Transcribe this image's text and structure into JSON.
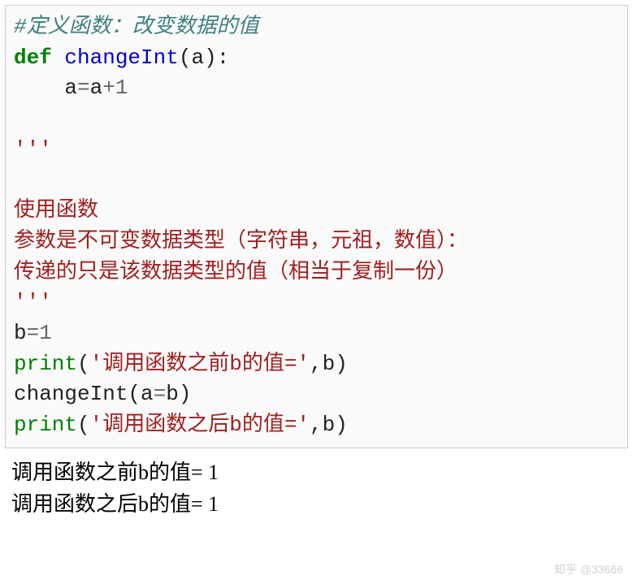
{
  "code": {
    "comment_line": "#定义函数：改变数据的值",
    "def_kw": "def",
    "func_name": "changeInt",
    "param_open": "(a):",
    "body_indent": "    ",
    "body_lhs": "a",
    "body_eq": "=",
    "body_rhs_a": "a",
    "body_plus": "+",
    "body_one": "1",
    "triple_open": "'''",
    "doc_line1": "使用函数",
    "doc_line2": "参数是不可变数据类型（字符串，元祖，数值）：",
    "doc_line3": "传递的只是该数据类型的值（相当于复制一份）",
    "triple_close": "'''",
    "assign_b": "b",
    "assign_eq": "=",
    "assign_val": "1",
    "print1_fn": "print",
    "print1_open": "(",
    "print1_str": "'调用函数之前b的值='",
    "print1_rest": ",b)",
    "call_line": "changeInt(a",
    "call_eq": "=",
    "call_rest": "b)",
    "print2_fn": "print",
    "print2_open": "(",
    "print2_str": "'调用函数之后b的值='",
    "print2_rest": ",b)"
  },
  "output": {
    "line1": "调用函数之前b的值= 1",
    "line2": "调用函数之后b的值= 1"
  },
  "watermark": "知乎 @33666"
}
